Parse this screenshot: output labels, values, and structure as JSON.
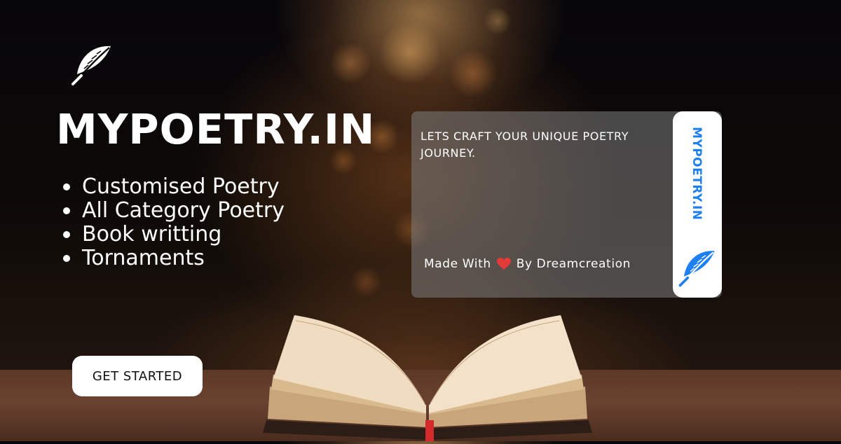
{
  "brand": {
    "title": "MYPOETRY.IN",
    "logo_icon": "feather-icon"
  },
  "features": [
    "Customised Poetry",
    "All Category Poetry",
    "Book writting",
    "Tornaments"
  ],
  "cta": {
    "label": "GET STARTED"
  },
  "card": {
    "tagline": "LETS CRAFT YOUR UNIQUE POETRY JOURNEY.",
    "credit_prefix": "Made With",
    "credit_icon": "heart-icon",
    "credit_suffix": "By Dreamcreation",
    "vertical_brand": "MYPOETRY.IN",
    "strip_logo_icon": "feather-icon"
  },
  "colors": {
    "accent_blue": "#1e7ff0",
    "heart_red": "#e33a3a",
    "text_white": "#ffffff"
  }
}
